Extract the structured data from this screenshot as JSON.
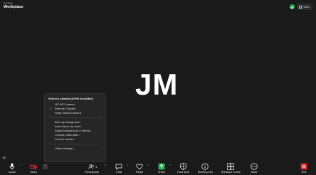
{
  "app": {
    "brand_small": "ZOOM",
    "brand_big": "Workplace",
    "view_label": "View"
  },
  "stage": {
    "initials": "JM",
    "self_badge": "M"
  },
  "camera_menu": {
    "title": "Select a camera (Alt+N to switch)",
    "cameras": [
      {
        "label": "HP HD Camera",
        "checked": false
      },
      {
        "label": "Remote Camera",
        "checked": true
      },
      {
        "label": "Snap Virtual Camera",
        "checked": false
      }
    ],
    "options": [
      {
        "label": "Blur my background"
      },
      {
        "label": "Auto-frame my video"
      },
      {
        "label": "Adjust background & effects..."
      },
      {
        "label": "Choose video filter..."
      },
      {
        "label": "Choose avatar..."
      }
    ],
    "settings_label": "Video settings..."
  },
  "toolbar": {
    "audio": "Audio",
    "video": "Video",
    "participants": "Participants",
    "participants_count": "1",
    "chat": "Chat",
    "react": "React",
    "share": "Share",
    "host_tools": "Host tools",
    "meeting_info": "Meeting info",
    "breakout_rooms": "Breakout rooms",
    "more": "More",
    "end": "End"
  },
  "colors": {
    "background": "#1a1a1a",
    "share_green": "#23b14d",
    "video_off_red": "#e23b3b",
    "end_red": "#e02828"
  }
}
